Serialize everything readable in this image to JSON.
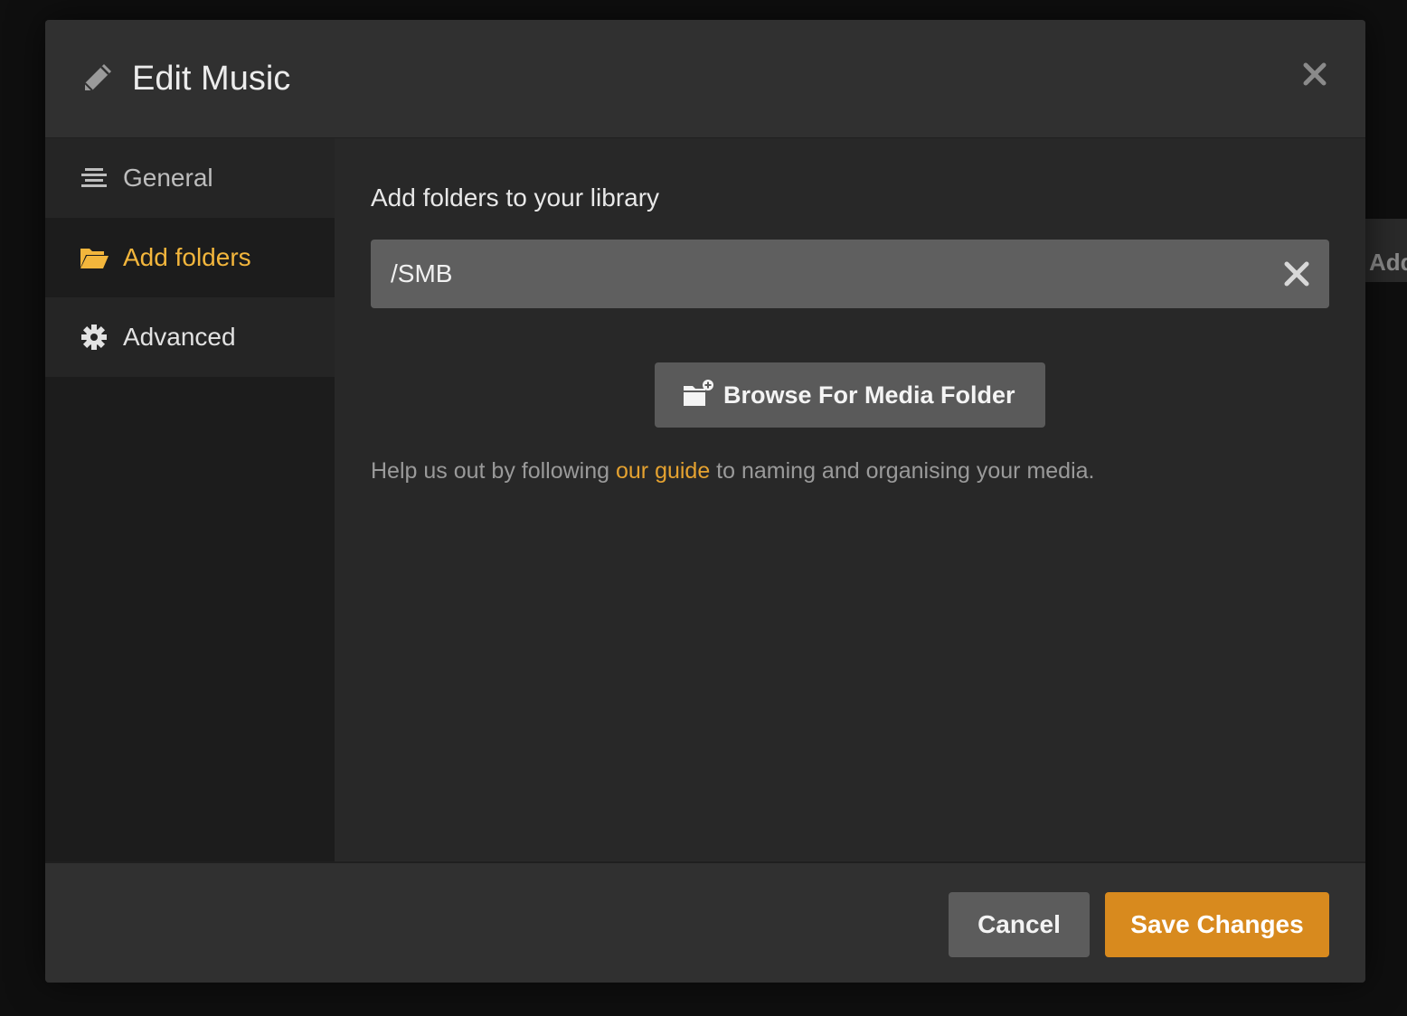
{
  "background": {
    "partial_button_text": "Add"
  },
  "modal": {
    "title": "Edit Music",
    "header_icon": "pencil-icon",
    "close_icon": "close-icon"
  },
  "sidebar": {
    "items": [
      {
        "label": "General",
        "icon": "align-lines-icon",
        "active": false
      },
      {
        "label": "Add folders",
        "icon": "folder-open-icon",
        "active": true
      },
      {
        "label": "Advanced",
        "icon": "gear-icon",
        "active": false
      }
    ]
  },
  "content": {
    "section_title": "Add folders to your library",
    "folders": [
      {
        "path": "/SMB"
      }
    ],
    "browse_button_label": "Browse For Media Folder",
    "help_prefix": "Help us out by following ",
    "help_link": "our guide",
    "help_suffix": " to naming and organising your media."
  },
  "footer": {
    "cancel_label": "Cancel",
    "save_label": "Save Changes"
  },
  "colors": {
    "accent": "#e5a230",
    "save_button": "#d88a1e",
    "active_nav": "#f3b63c"
  }
}
